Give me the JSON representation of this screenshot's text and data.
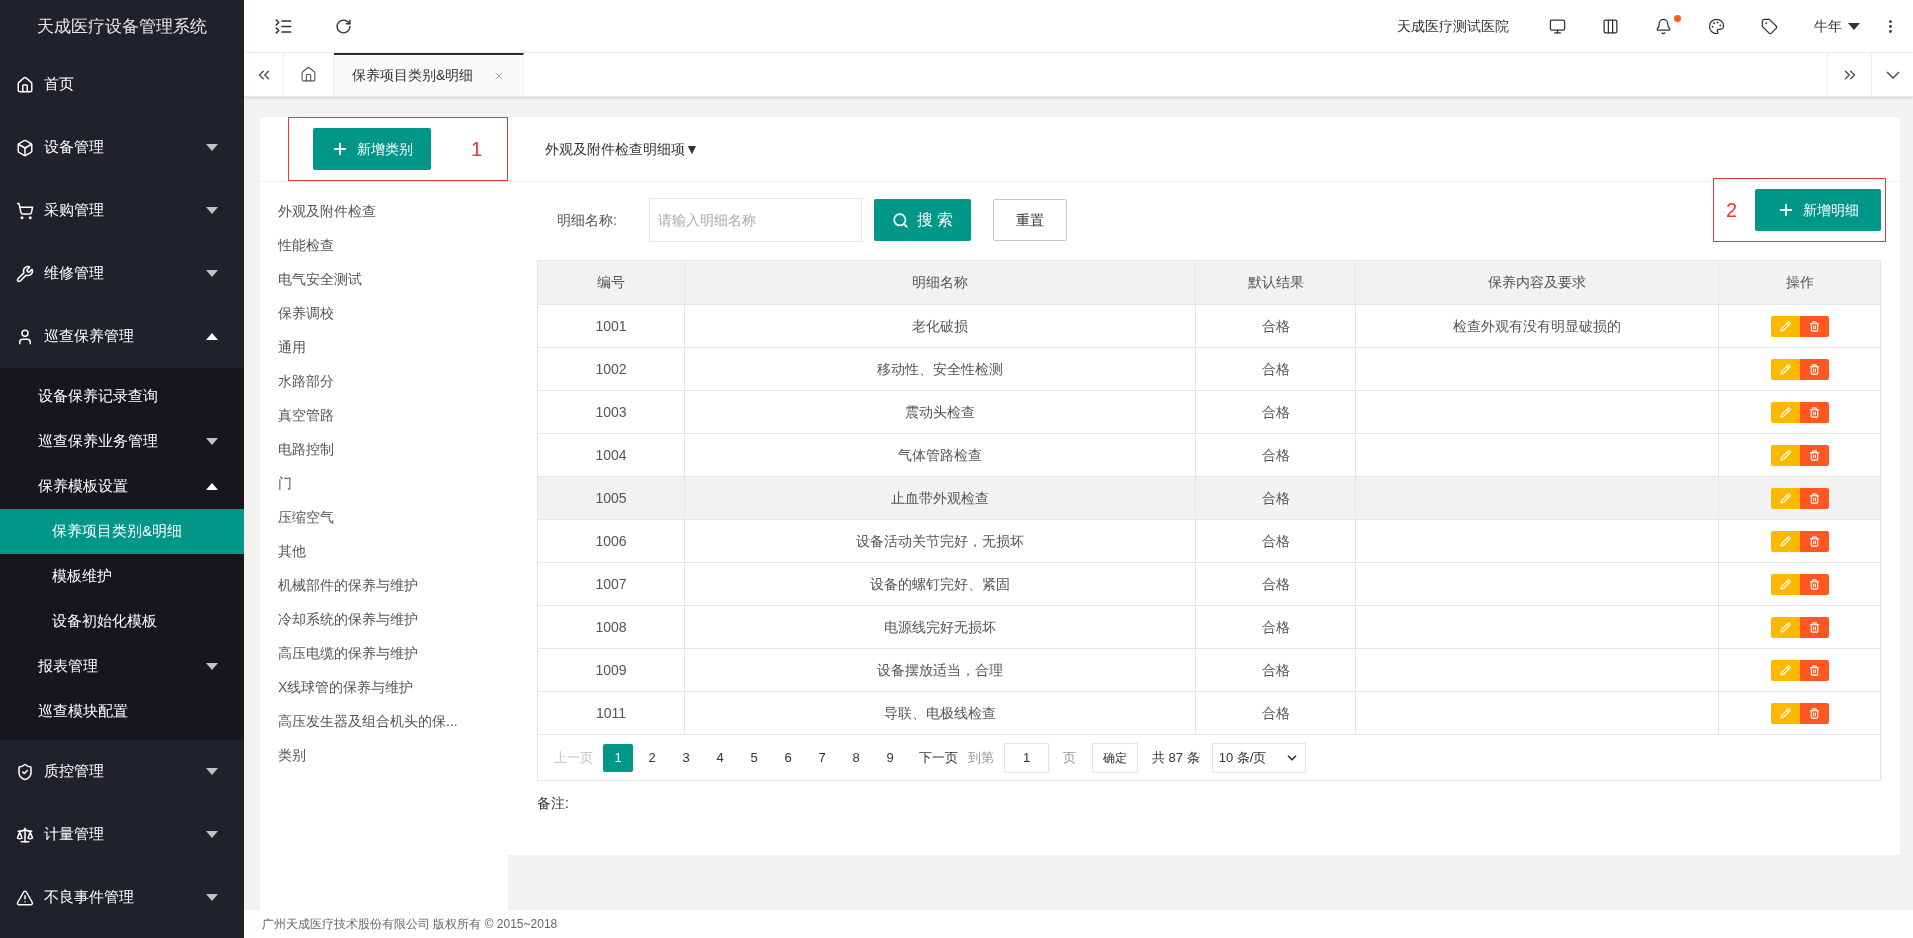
{
  "app_title": "天成医疗设备管理系统",
  "sidebar": {
    "items": [
      {
        "label": "首页",
        "selected": false
      },
      {
        "label": "设备管理",
        "expanded": false,
        "selected": false
      },
      {
        "label": "采购管理",
        "expanded": false,
        "selected": false
      },
      {
        "label": "维修管理",
        "expanded": false,
        "selected": false
      },
      {
        "label": "巡查保养管理",
        "expanded": true,
        "selected": false,
        "children": [
          {
            "label": "设备保养记录查询",
            "selected": false
          },
          {
            "label": "巡查保养业务管理",
            "expanded": false,
            "selected": false
          },
          {
            "label": "保养模板设置",
            "expanded": true,
            "selected": false,
            "children": [
              {
                "label": "保养项目类别&明细",
                "selected": true
              },
              {
                "label": "模板维护",
                "selected": false
              },
              {
                "label": "设备初始化模板",
                "selected": false
              }
            ]
          },
          {
            "label": "报表管理",
            "expanded": false,
            "selected": false
          },
          {
            "label": "巡查模块配置",
            "selected": false
          }
        ]
      },
      {
        "label": "质控管理",
        "expanded": false,
        "selected": false
      },
      {
        "label": "计量管理",
        "expanded": false,
        "selected": false
      },
      {
        "label": "不良事件管理",
        "expanded": false,
        "selected": false
      }
    ]
  },
  "header": {
    "hospital": "天成医疗测试医院",
    "user": "牛年",
    "notification_dot": true
  },
  "tabs": [
    {
      "label": "保养项目类别&明细",
      "selected": true
    }
  ],
  "categories": {
    "add_button": "新增类别",
    "annotation": "1",
    "items": [
      "外观及附件检查",
      "性能检查",
      "电气安全测试",
      "保养调校",
      "通用",
      "水路部分",
      "真空管路",
      "电路控制",
      "门",
      "压缩空气",
      "其他",
      "机械部件的保养与维护",
      "冷却系统的保养与维护",
      "高压电缆的保养与维护",
      "X线球管的保养与维护",
      "高压发生器及组合机头的保...",
      "类别"
    ]
  },
  "detail": {
    "title": "外观及附件检查明细项▼",
    "search": {
      "label": "明细名称:",
      "placeholder": "请输入明细名称",
      "search_button": "搜 索",
      "reset_button": "重置"
    },
    "add_button": "新增明细",
    "annotation": "2",
    "table": {
      "columns": [
        "编号",
        "明细名称",
        "默认结果",
        "保养内容及要求",
        "操作"
      ],
      "rows": [
        {
          "code": "1001",
          "name": "老化破损",
          "result": "合格",
          "requirement": "检查外观有没有明显破损的",
          "selected": false
        },
        {
          "code": "1002",
          "name": "移动性、安全性检测",
          "result": "合格",
          "selected": false
        },
        {
          "code": "1003",
          "name": "震动头检查",
          "result": "合格",
          "selected": false
        },
        {
          "code": "1004",
          "name": "气体管路检查",
          "result": "合格",
          "selected": false
        },
        {
          "code": "1005",
          "name": "止血带外观检查",
          "result": "合格",
          "selected": true
        },
        {
          "code": "1006",
          "name": "设备活动关节完好，无损坏",
          "result": "合格",
          "selected": false
        },
        {
          "code": "1007",
          "name": "设备的螺钉完好、紧固",
          "result": "合格",
          "selected": false
        },
        {
          "code": "1008",
          "name": "电源线完好无损坏",
          "result": "合格",
          "selected": false
        },
        {
          "code": "1009",
          "name": "设备摆放适当，合理",
          "result": "合格",
          "selected": false
        },
        {
          "code": "1011",
          "name": "导联、电极线检查",
          "result": "合格",
          "selected": false
        }
      ]
    },
    "pagination": {
      "prev": "上一页",
      "prev_disabled": true,
      "pages": [
        {
          "label": "1",
          "selected": true
        },
        {
          "label": "2",
          "selected": false
        },
        {
          "label": "3",
          "selected": false
        },
        {
          "label": "4",
          "selected": false
        },
        {
          "label": "5",
          "selected": false
        },
        {
          "label": "6",
          "selected": false
        },
        {
          "label": "7",
          "selected": false
        },
        {
          "label": "8",
          "selected": false
        },
        {
          "label": "9",
          "selected": false
        }
      ],
      "next": "下一页",
      "goto_label": "到第",
      "goto_value": "1",
      "page_unit": "页",
      "confirm": "确定",
      "total": "共 87 条",
      "page_size": "10 条/页"
    },
    "remark_label": "备注:"
  },
  "footer": "广州天成医疗技术股份有限公司 版权所有 © 2015~2018"
}
